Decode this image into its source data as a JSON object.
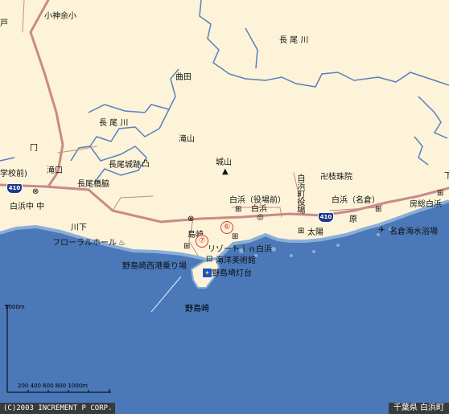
{
  "map": {
    "labels": {
      "kobutsu": "小神余小",
      "upper_left_partial": "戸",
      "nagao_river_ne": "長 尾 川",
      "magata": "曲田",
      "nagao_river_w": "長 尾 川",
      "takiyama": "滝山",
      "joyama": "城山",
      "nagao_castle": "長尾城跡",
      "takiguchi": "滝口",
      "school_partial": "学校前)",
      "nagao_bridge": "長尾橋脇",
      "shirahama_naka": "白浜中 中",
      "kawashita": "川下",
      "floral_hall": "フローラルホール",
      "shirahama_yakuba": "白浜（役場前）",
      "shirahama_town": "白浜",
      "shirahama_cho_vertical": "白浜町役場",
      "gongen_fall": "卍枝珠院",
      "shirahama_nagura": "白浜（名倉）",
      "boshu_shirahama": "房総白浜",
      "nojima_zaki_top": "島崎",
      "resort": "リゾートｉｎ白浜",
      "kaiyo_museum": "海洋美術館",
      "nojima_west": "野島崎西港乗り場",
      "nojima_lighthouse": "野島埼灯台",
      "nojima_zaki": "野島崎",
      "taiyo": "太陽",
      "hara": "原",
      "nagura_beach": "名倉海水浴場",
      "right_edge_partial": "下"
    },
    "route_number": "410",
    "badges": {
      "six": "⑥",
      "seven": "⑦"
    },
    "colors": {
      "land": "#fcf3d8",
      "sea": "#4a78b8",
      "shore_light": "#8aaed8",
      "river": "#5a7fc0",
      "main_road": "#c88a8a",
      "route_shield": "#1b3a8c"
    }
  },
  "scale": {
    "vertical_label": "1000m",
    "horizontal_label": "200  400  600  800 1000m"
  },
  "footer": {
    "copyright": "(C)2003 INCREMENT P CORP.",
    "place": "千葉県 白浜町"
  }
}
